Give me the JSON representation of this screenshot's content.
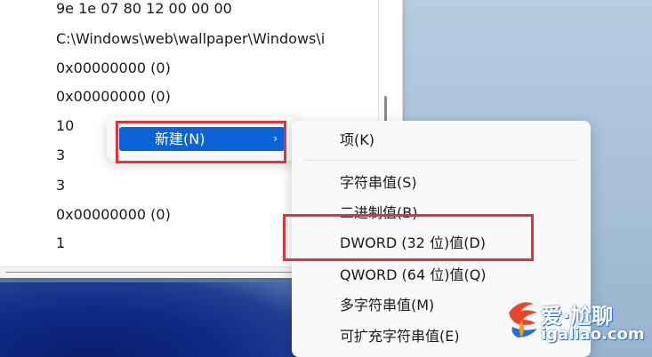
{
  "registry_values": [
    "9e 1e 07 80 12 00 00 00",
    "C:\\Windows\\web\\wallpaper\\Windows\\i",
    "0x00000000 (0)",
    "0x00000000 (0)",
    "10",
    "3",
    "3",
    "0x00000000 (0)",
    "1"
  ],
  "menu1": {
    "new_label": "新建(N)",
    "submenu_arrow": "›"
  },
  "menu2": {
    "items": [
      "项(K)",
      "字符串值(S)",
      "二进制值(B)",
      "DWORD (32 位)值(D)",
      "QWORD (64 位)值(Q)",
      "多字符串值(M)",
      "可扩充字符串值(E)"
    ]
  },
  "watermark": {
    "line1": "爱·尬聊",
    "line2": "igaliao.com"
  },
  "colors": {
    "highlight": "#0a64d8",
    "annotation_red": "#e0333a"
  },
  "icons": {
    "submenu_arrow": "chevron-right-icon",
    "watermark_logo": "bird-logo-icon"
  }
}
